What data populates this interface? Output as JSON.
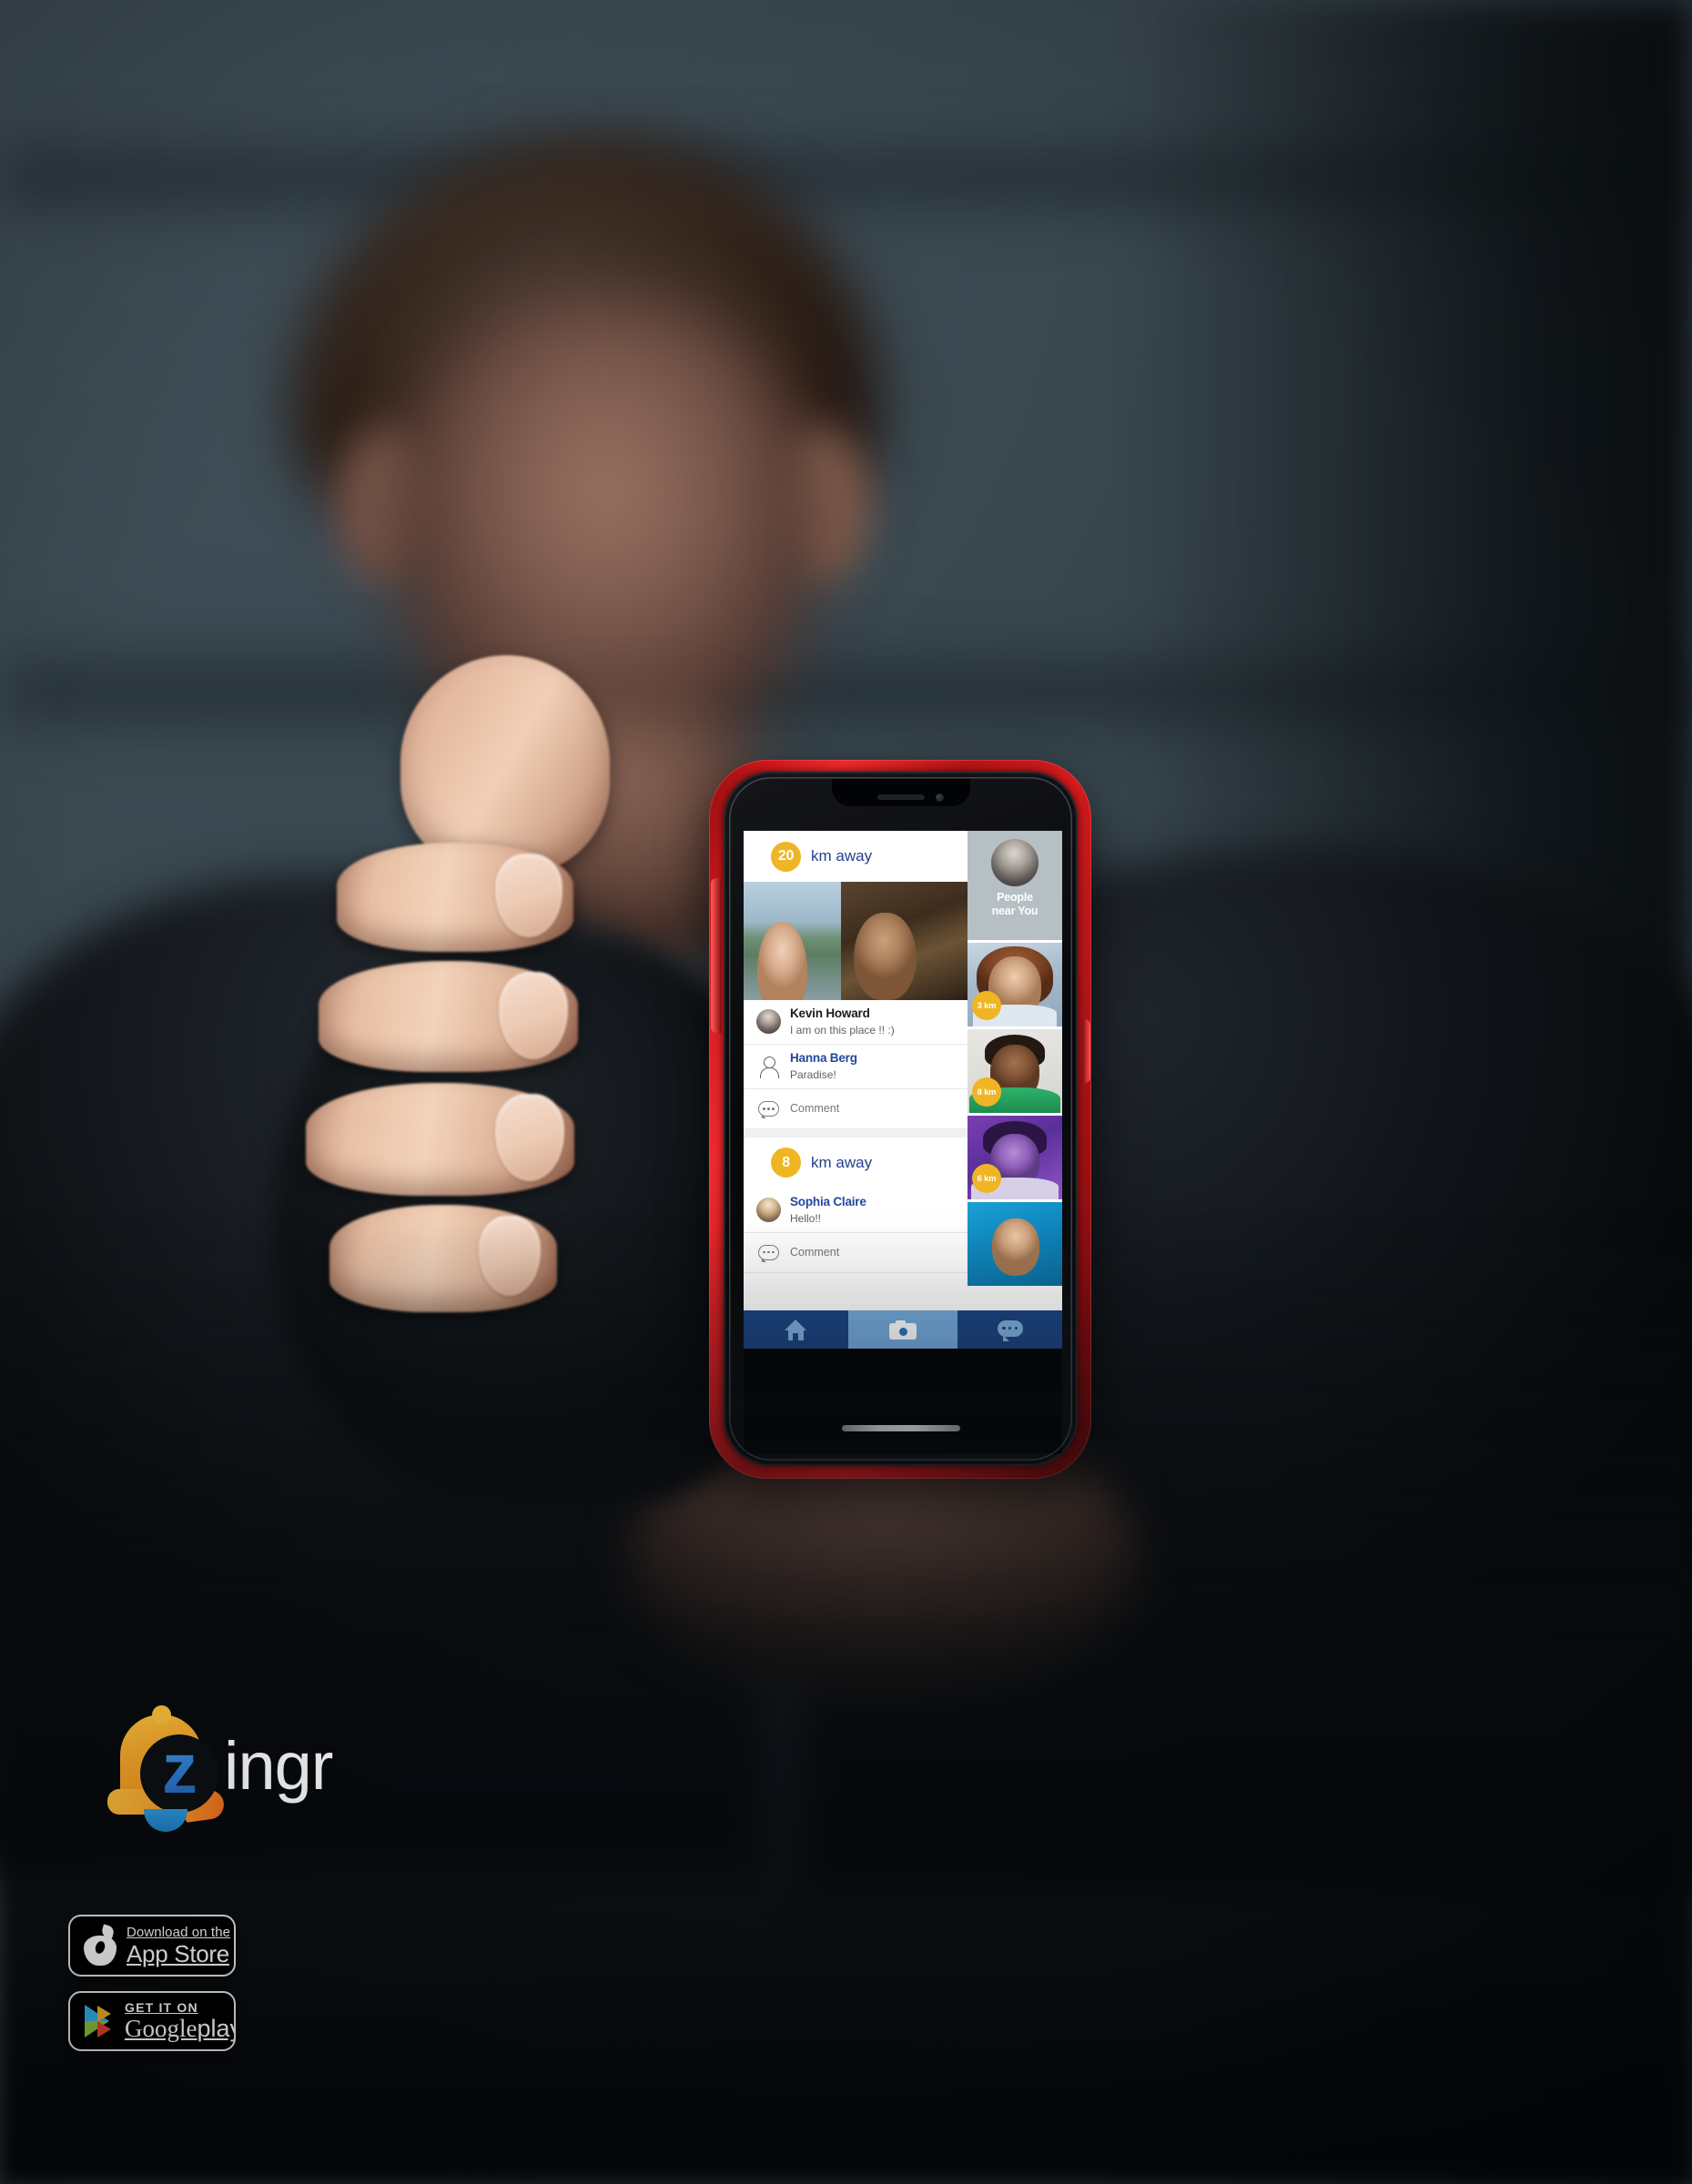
{
  "background": {
    "scene": "blurred-young-man-holding-phone",
    "wall_color": "#3a4750"
  },
  "phone": {
    "case_color": "#d4181c",
    "app": {
      "accent_yellow": "#efb525",
      "name_blue": "#24489c",
      "nav_dark_blue": "#1d4482",
      "nav_active_blue": "#74abdd",
      "feed": [
        {
          "distance_value": "20",
          "distance_label": "km away",
          "photo_alt": "two-women-smiling-outdoors",
          "posts": [
            {
              "author": "Kevin Howard",
              "message": "I am on this place !! :)",
              "author_style": "dark",
              "avatar": "kevin-avatar"
            },
            {
              "author": "Hanna Berg",
              "message": "Paradise!",
              "author_style": "blue",
              "avatar": "user-outline-icon"
            }
          ],
          "comment_label": "Comment"
        },
        {
          "distance_value": "8",
          "distance_label": "km away",
          "posts": [
            {
              "author": "Sophia Claire",
              "message": "Hello!!",
              "author_style": "blue",
              "avatar": "sophia-avatar"
            }
          ],
          "comment_label": "Comment"
        }
      ],
      "people_rail": {
        "title_line1": "People",
        "title_line2": "near You",
        "items": [
          {
            "photo_alt": "woman-auburn-hair",
            "distance": "3 km"
          },
          {
            "photo_alt": "man-green-shirt",
            "distance": "8 km"
          },
          {
            "photo_alt": "woman-purple-light",
            "distance": "6 km"
          },
          {
            "photo_alt": "woman-blue-headscarf",
            "distance": ""
          }
        ]
      },
      "nav": [
        {
          "icon": "home-icon",
          "active": false
        },
        {
          "icon": "camera-icon",
          "active": true
        },
        {
          "icon": "chat-bubble-icon",
          "active": false
        }
      ]
    }
  },
  "logo": {
    "mark": "bell-icon",
    "letter": "z",
    "wordmark": "ingr",
    "mark_color": "#fba929",
    "letter_color": "#2f7fd6"
  },
  "store_badges": [
    {
      "id": "app-store",
      "icon": "apple-logo-icon",
      "line1": "Download on the",
      "line2": "App Store"
    },
    {
      "id": "google-play",
      "icon": "google-play-triangle-icon",
      "line1": "GET IT ON",
      "line2_brand": "Google",
      "line2_play": "play"
    }
  ]
}
